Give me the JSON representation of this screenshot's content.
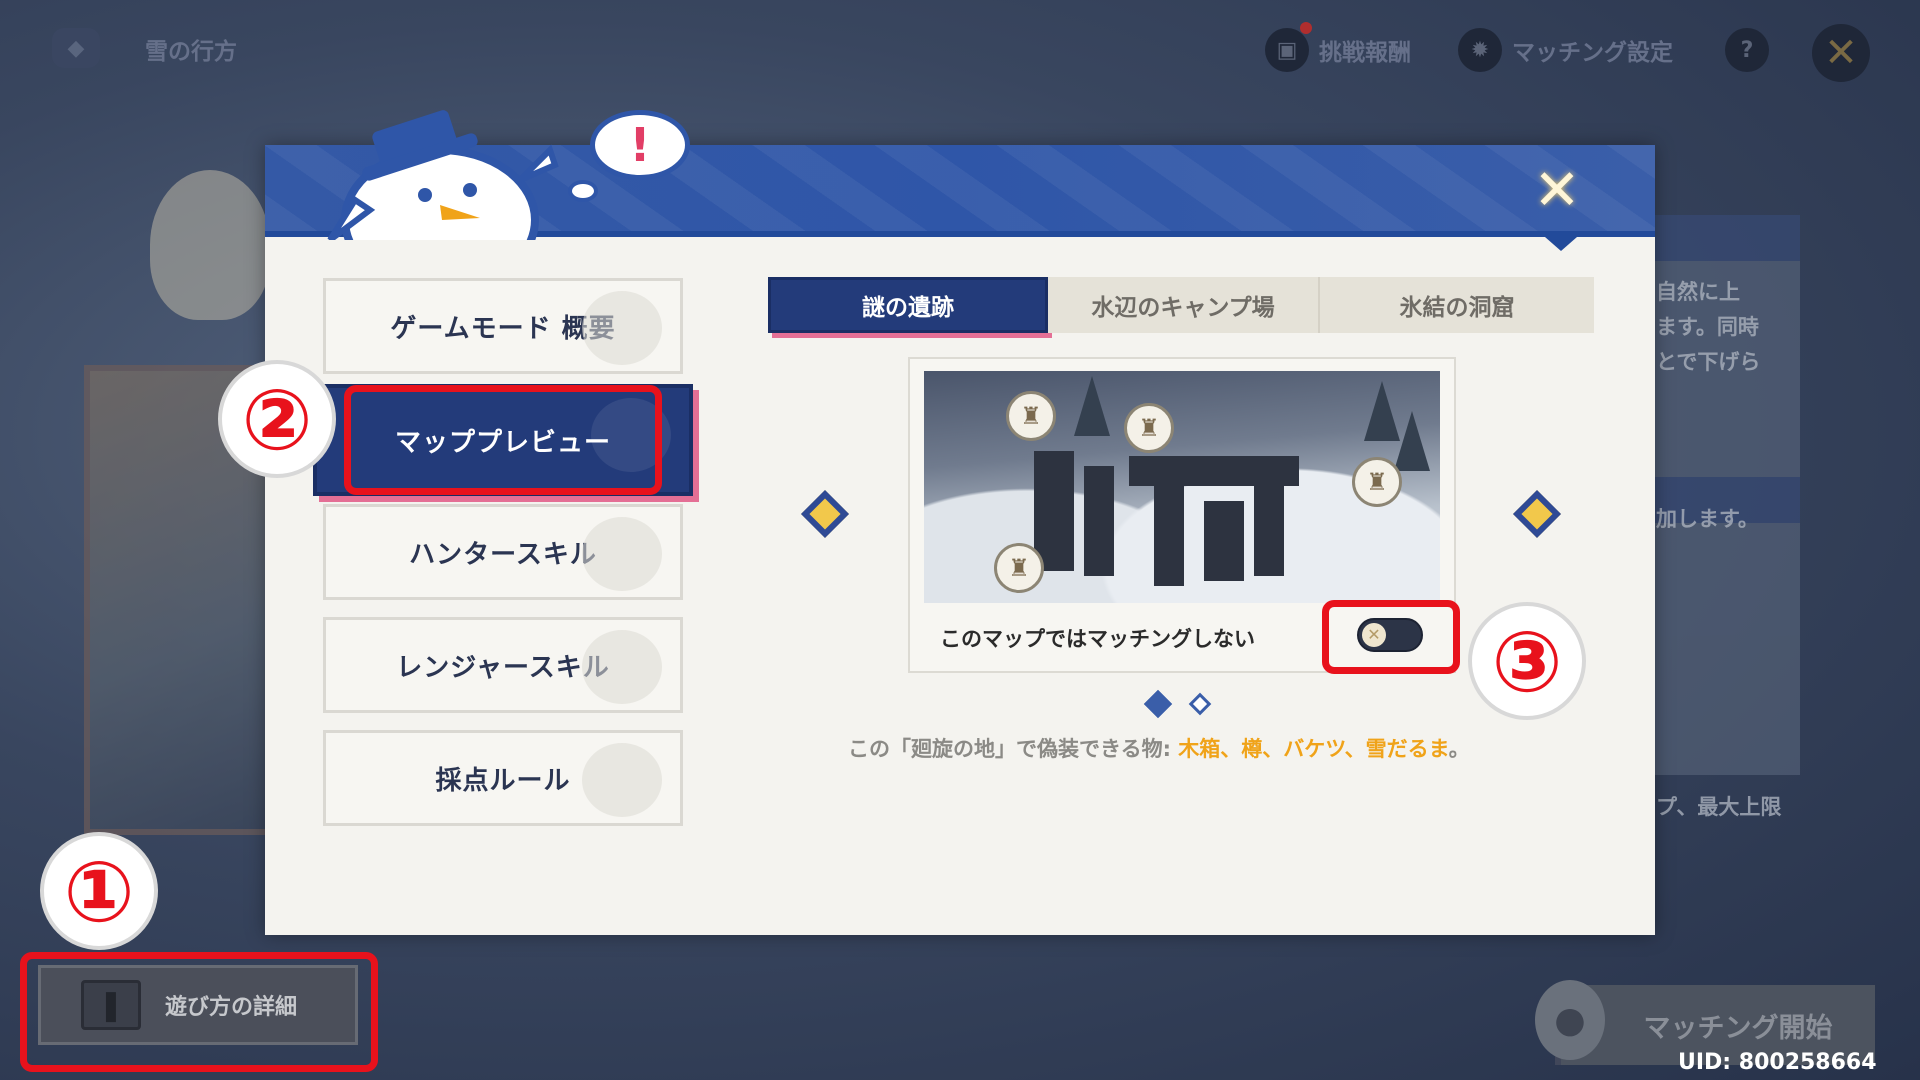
{
  "topbar": {
    "title": "雪の行方",
    "reward_label": "挑戦報酬",
    "match_settings_label": "マッチング設定",
    "help_icon": "?",
    "close_icon": "✕"
  },
  "modal": {
    "close_icon": "✕",
    "speech": "!",
    "side_menu": [
      {
        "label": "ゲームモード 概要"
      },
      {
        "label": "マッププレビュー"
      },
      {
        "label": "ハンタースキル"
      },
      {
        "label": "レンジャースキル"
      },
      {
        "label": "採点ルール"
      }
    ],
    "active_side_index": 1,
    "tabs": [
      {
        "label": "謎の遺跡"
      },
      {
        "label": "水辺のキャンプ場"
      },
      {
        "label": "氷結の洞窟"
      }
    ],
    "active_tab_index": 0,
    "map_toggle_label": "このマップではマッチングしない",
    "map_toggle_on": false,
    "toggle_knob": "✕",
    "page_count": 2,
    "current_page": 1,
    "disguise_prefix": "この「廻旋の地」で偽装できる物: ",
    "disguise_items": "木箱、樽、バケツ、雪だるま",
    "disguise_suffix": "。"
  },
  "background": {
    "right_text_1": "自然に上",
    "right_text_2": "ます。同時",
    "right_text_3": "とで下げら",
    "right_text_4": "加します。",
    "right_text_5": "プ、最大上限"
  },
  "bottom": {
    "how_to_label": "遊び方の詳細",
    "match_start_label": "マッチング開始",
    "uid": "UID: 800258664"
  },
  "annotations": {
    "num1": "①",
    "num2": "②",
    "num3": "③"
  },
  "colors": {
    "accent_blue": "#233b7a",
    "highlight_orange": "#f0a319",
    "annotation_red": "#e8121c",
    "pink_shadow": "#e46f95"
  }
}
